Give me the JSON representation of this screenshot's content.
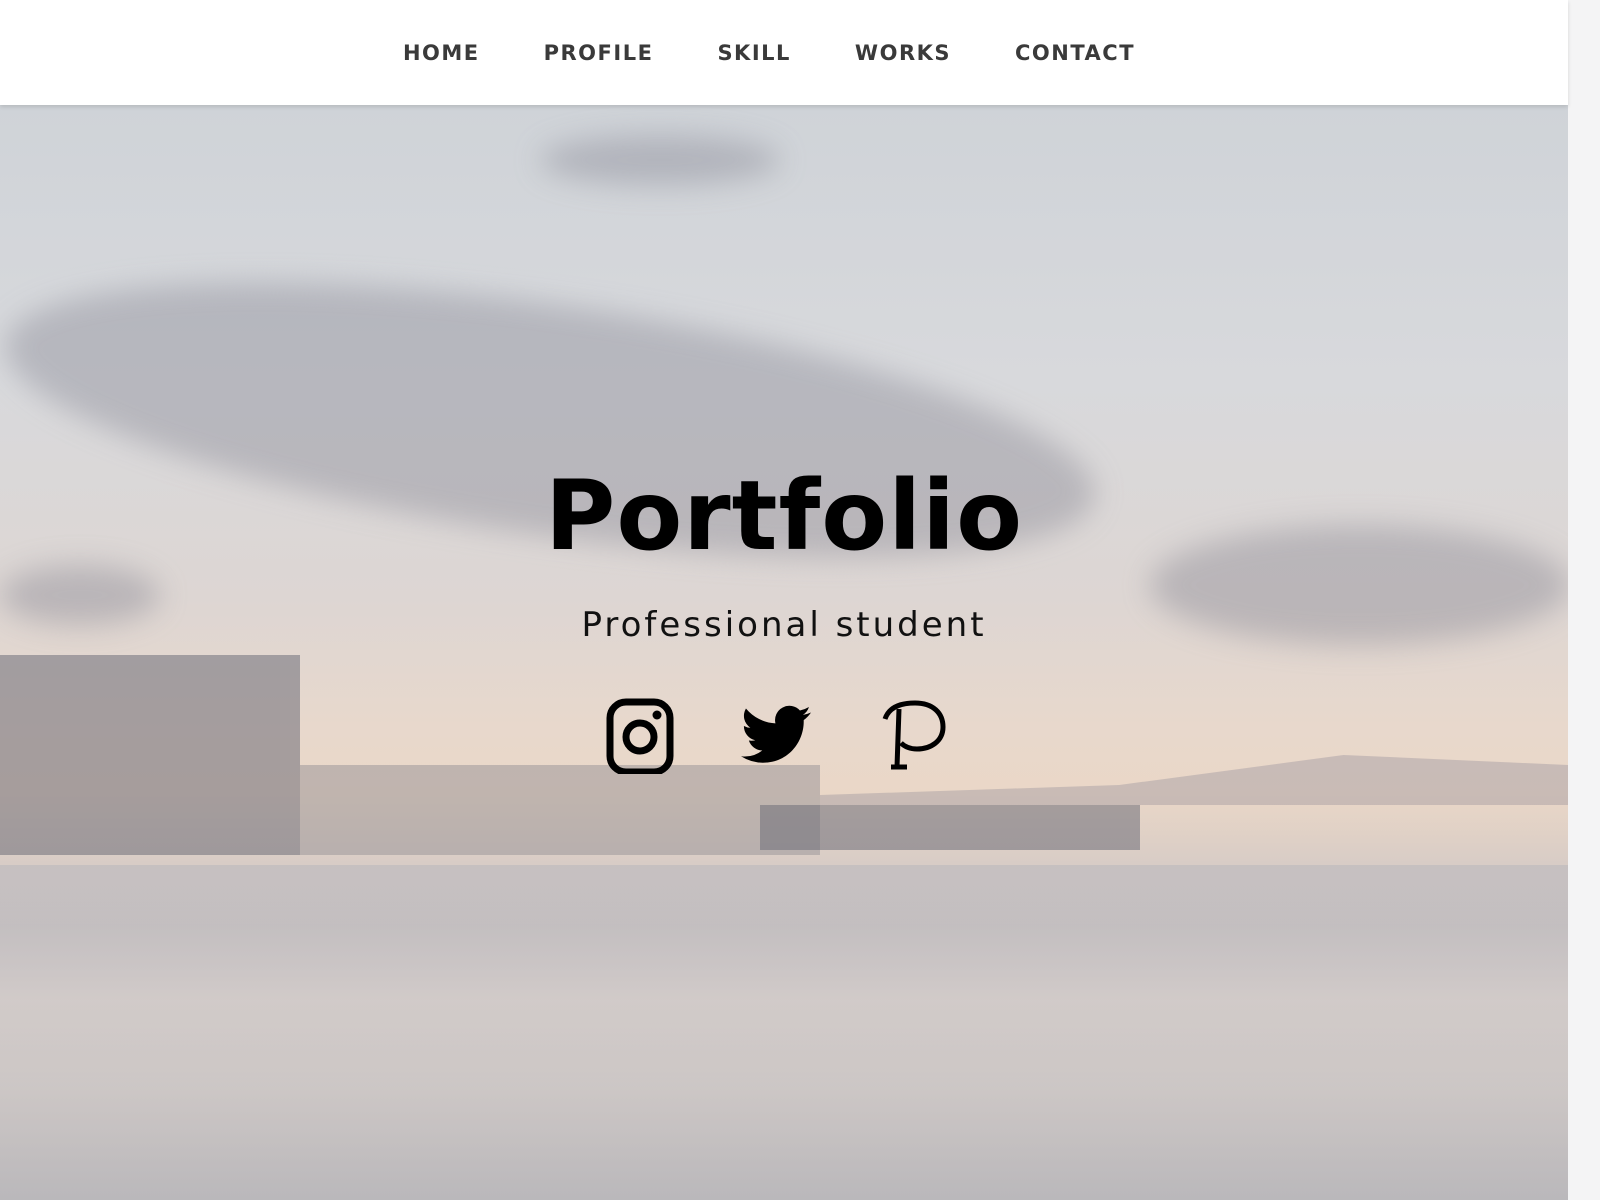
{
  "nav": {
    "items": [
      "HOME",
      "PROFILE",
      "SKILL",
      "WORKS",
      "CONTACT"
    ]
  },
  "hero": {
    "title": "Portfolio",
    "subtitle": "Professional student",
    "social": [
      "instagram-icon",
      "twitter-icon",
      "pinterest-icon"
    ]
  }
}
